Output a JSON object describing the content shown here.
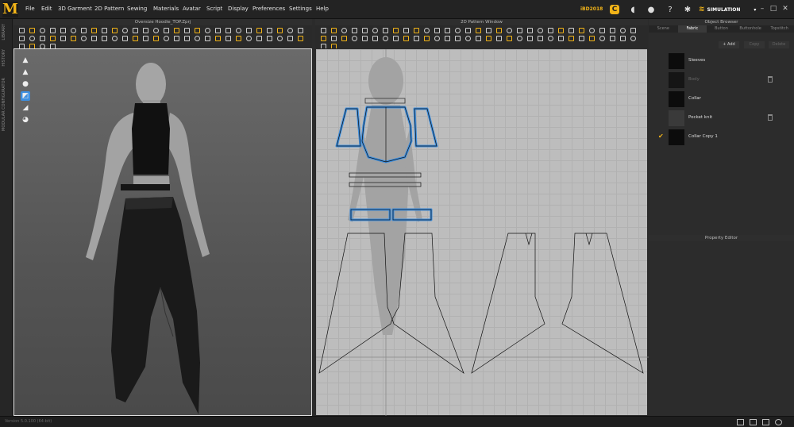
{
  "app": {
    "logo": "M"
  },
  "menu": [
    "File",
    "Edit",
    "3D Garment",
    "2D Pattern",
    "Sewing",
    "Materials",
    "Avatar",
    "Script",
    "Display",
    "Preferences",
    "Settings",
    "Help"
  ],
  "top_right": {
    "brand_text": "iBD2018",
    "mode_label": "SIMULATION"
  },
  "left_tabs": [
    "LIBRARY",
    "HISTORY",
    "MODULAR CONFIGURATOR"
  ],
  "panels": {
    "view3d_title": "Oversize Hoodie_TOP.Zprj",
    "view2d_title": "2D Pattern Window",
    "object_browser_title": "Object Browser",
    "property_editor_title": "Property Editor"
  },
  "object_browser": {
    "tabs": [
      {
        "label": "Scene",
        "active": false
      },
      {
        "label": "Fabric",
        "active": true
      },
      {
        "label": "Button",
        "active": false
      },
      {
        "label": "Buttonhole",
        "active": false
      },
      {
        "label": "Topstitch",
        "active": false
      }
    ],
    "add_label": "+ Add",
    "copy_label": "Copy",
    "delete_label": "Delete",
    "fabrics": [
      {
        "name": "Sleeves",
        "state": "normal",
        "checked": false,
        "trash": false
      },
      {
        "name": "Body",
        "state": "dim",
        "checked": false,
        "trash": true
      },
      {
        "name": "Collar",
        "state": "normal",
        "checked": false,
        "trash": false
      },
      {
        "name": "Pocket knit",
        "state": "grey",
        "checked": false,
        "trash": true
      },
      {
        "name": "Collar Copy 1",
        "state": "normal",
        "checked": true,
        "trash": false
      }
    ]
  },
  "status": {
    "text": "Version 5.0.100 (64-bit)"
  },
  "colors": {
    "accent": "#f2b418",
    "selection": "#3d8fe0",
    "grid_bg": "#bdbdbd"
  }
}
